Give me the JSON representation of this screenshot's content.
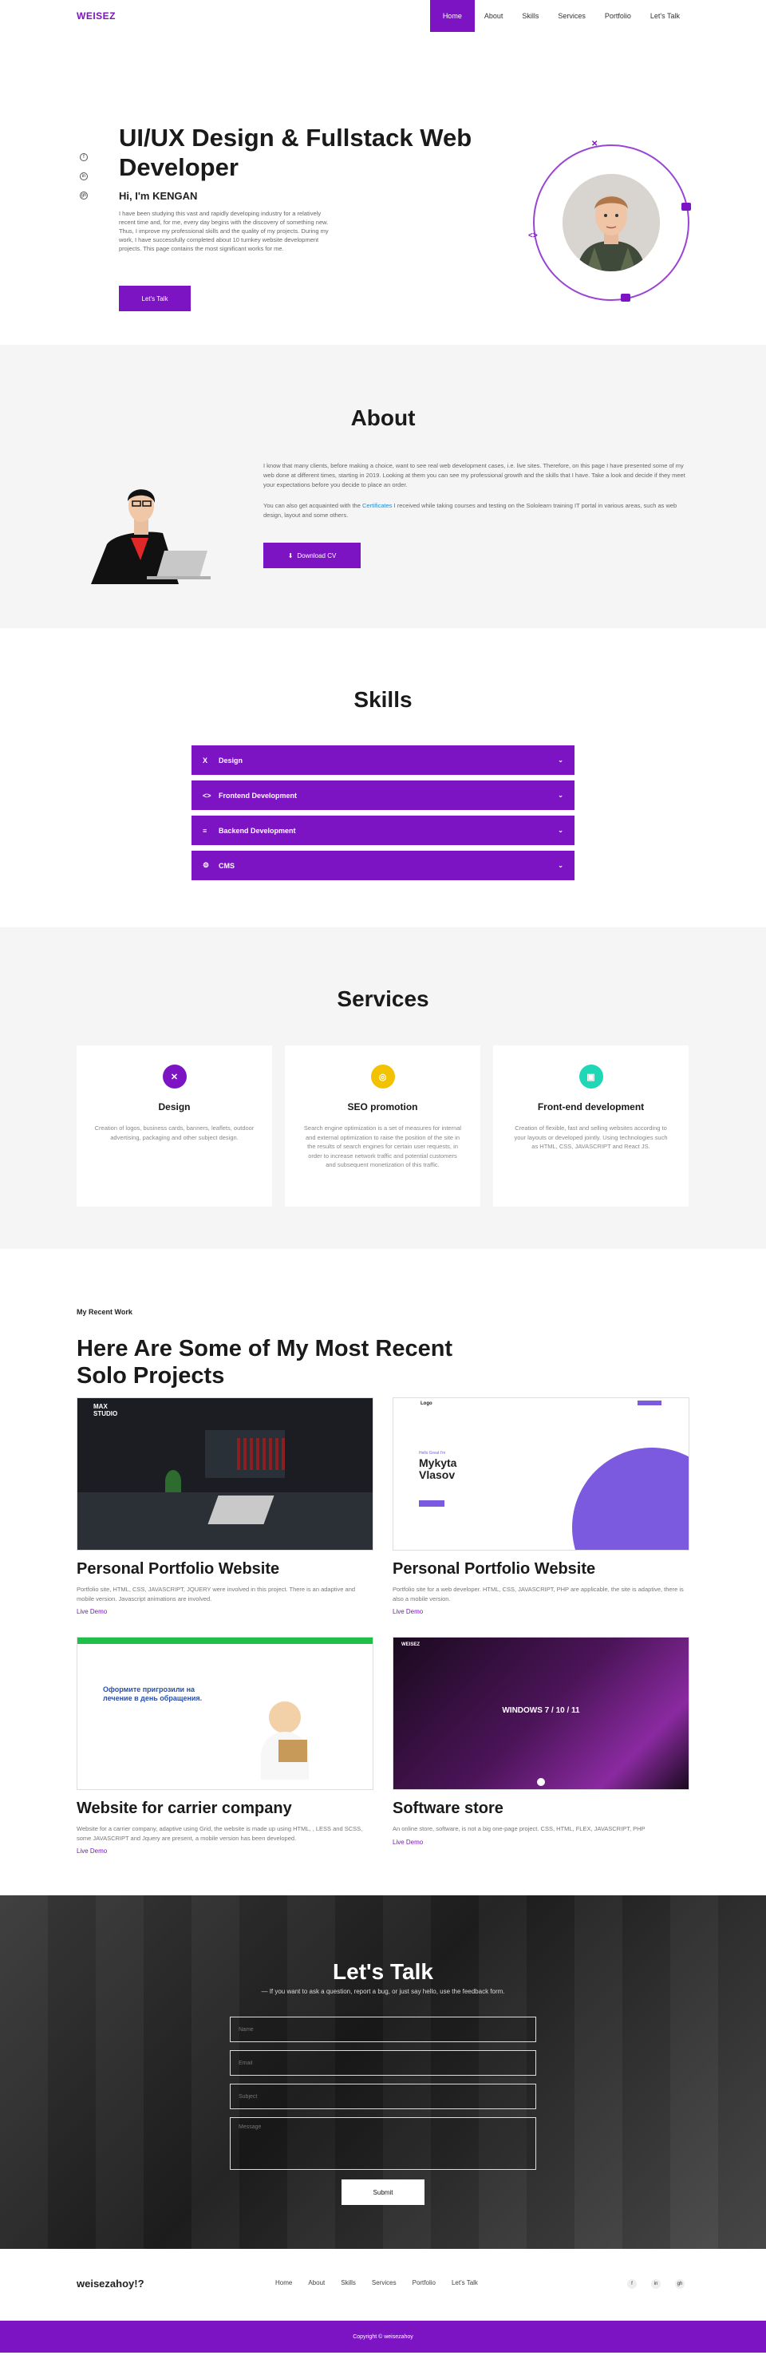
{
  "nav": {
    "brand": "WEISEZ",
    "links": [
      "Home",
      "About",
      "Skills",
      "Services",
      "Portfolio",
      "Let's Talk"
    ]
  },
  "hero": {
    "title": "UI/UX Design & Fullstack Web Developer",
    "greeting": "Hi, I'm KENGAN",
    "text": "I have been studying this vast and rapidly developing industry for a relatively recent time and, for me, every day begins with the discovery of something new. Thus, I improve my professional skills and the quality of my projects. During my work, I have successfully completed about 10 turnkey website development projects. This page contains the most significant works for me.",
    "button": "Let's Talk",
    "socials": [
      "f",
      "in",
      "gh"
    ]
  },
  "about": {
    "title": "About",
    "p1": "I know that many clients, before making a choice, want to see real web development cases, i.e. live sites. Therefore, on this page I have presented some of my web done at different times, starting in 2019. Looking at them you can see my professional growth and the skills that I have. Take a look and decide if they meet your expectations before you decide to place an order.",
    "p2_before": "You can also get acquainted with the ",
    "p2_link": "Certificates",
    "p2_after": " I received while taking courses and testing on the Sololearn training IT portal in various areas, such as web design, layout and some others.",
    "button": "Download CV"
  },
  "skills": {
    "title": "Skills",
    "items": [
      {
        "label": "Design",
        "icon": "X"
      },
      {
        "label": "Frontend Development",
        "icon": "<>"
      },
      {
        "label": "Backend Development",
        "icon": "≡"
      },
      {
        "label": "CMS",
        "icon": "⚙"
      }
    ]
  },
  "services": {
    "title": "Services",
    "cards": [
      {
        "title": "Design",
        "text": "Creation of logos, business cards, banners, leaflets, outdoor advertising, packaging and other subject design.",
        "color": "#7c14c4",
        "icon": "✕"
      },
      {
        "title": "SEO promotion",
        "text": "Search engine optimization is a set of measures for internal and external optimization to raise the position of the site in the results of search engines for certain user requests, in order to increase network traffic and potential customers and subsequent monetization of this traffic.",
        "color": "#f2c200",
        "icon": "◎"
      },
      {
        "title": "Front-end development",
        "text": "Creation of flexible, fast and selling websites according to your layouts or developed jointly. Using technologies such as HTML, CSS, JAVASCRIPT and React JS.",
        "color": "#1ed7b4",
        "icon": "▣"
      }
    ]
  },
  "portfolio": {
    "kicker": "My Recent Work",
    "title": "Here Are Some of My Most Recent Solo Projects",
    "projects": [
      {
        "title": "Personal Portfolio Website",
        "text": "Portfolio site, HTML, CSS, JAVASCRIPT, JQUERY were involved in this project. There is an adaptive and mobile version. Javascript animations are involved.",
        "link": "Live Demo",
        "shot_label": "MAX STUDIO"
      },
      {
        "title": "Personal Portfolio Website",
        "text": "Portfolio site for a web developer. HTML, CSS, JAVASCRIPT, PHP are applicable, the site is adaptive, there is also a mobile version.",
        "link": "Live Demo",
        "shot_label": "Mykyta Vlasov",
        "shot_kicker": "Hello Great I'm",
        "shot_logo": "Logo"
      },
      {
        "title": "Website for carrier company",
        "text": "Website for a carrier company, adaptive using Grid, the website is made up using HTML, , LESS and SCSS, some JAVASCRIPT and Jquery are present, a mobile version has been developed.",
        "link": "Live Demo",
        "shot_label": "Оформите пригрозили на лечение в день обращения."
      },
      {
        "title": "Software store",
        "text": "An online store, software, is not a big one-page project. CSS, HTML, FLEX, JAVASCRIPT, PHP",
        "link": "Live Demo",
        "shot_label": "WINDOWS 7 / 10 / 11",
        "shot_logo": "WEISEZ"
      }
    ]
  },
  "talk": {
    "title": "Let's Talk",
    "subtitle": "— If you want to ask a question, report a bug, or just say hello, use the feedback form.",
    "name_placeholder": "Name",
    "email_placeholder": "Email",
    "subject_placeholder": "Subject",
    "message_placeholder": "Message",
    "submit": "Submit"
  },
  "footer": {
    "brand": "weisezahoy!?",
    "links": [
      "Home",
      "About",
      "Skills",
      "Services",
      "Portfolio",
      "Let's Talk"
    ],
    "socials": [
      "f",
      "in",
      "gh"
    ],
    "copyright": "Copyright © weisezahoy"
  },
  "colors": {
    "accent": "#7c14c4",
    "accent_light": "#9a44d6"
  }
}
